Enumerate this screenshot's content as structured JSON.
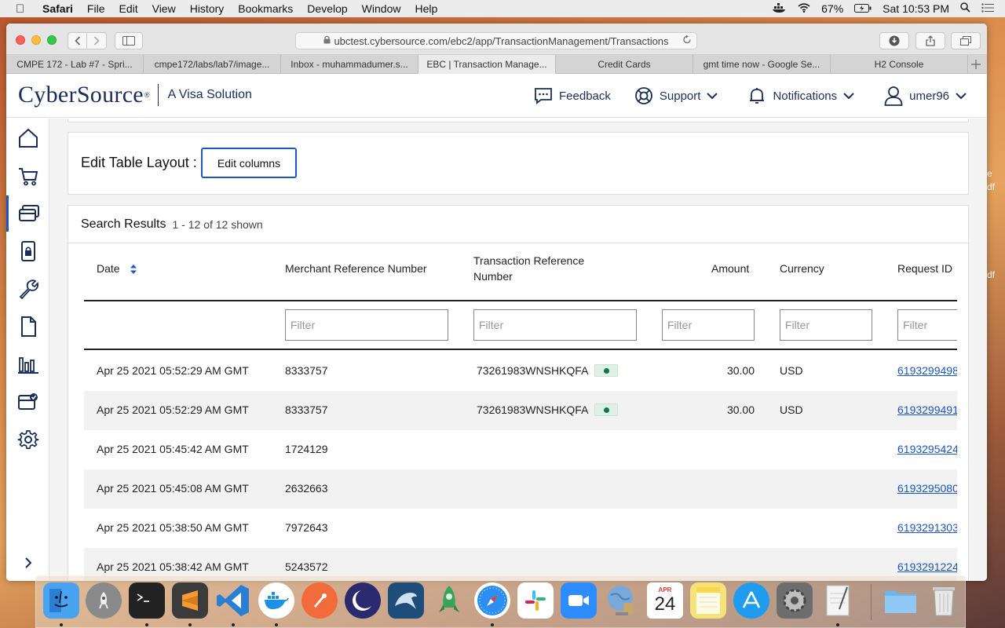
{
  "menubar": {
    "app": "Safari",
    "items": [
      "File",
      "Edit",
      "View",
      "History",
      "Bookmarks",
      "Develop",
      "Window",
      "Help"
    ],
    "battery": "67%",
    "clock": "Sat 10:53 PM"
  },
  "browser": {
    "url": "ubctest.cybersource.com/ebc2/app/TransactionManagement/Transactions",
    "tabs": [
      "CMPE 172 - Lab #7 - Spri...",
      "cmpe172/labs/lab7/image...",
      "Inbox - muhammadumer.s...",
      "EBC | Transaction Manage...",
      "Credit Cards",
      "gmt time now - Google Se...",
      "H2 Console"
    ],
    "active_tab_index": 3
  },
  "header": {
    "brand": "CyberSource",
    "brand_mark": "®",
    "tagline": "A Visa Solution",
    "feedback": "Feedback",
    "support": "Support",
    "notifications": "Notifications",
    "user": "umer96"
  },
  "sidebar": {
    "items": [
      "home-icon",
      "cart-icon",
      "cards-icon",
      "phone-lock-icon",
      "wrench-icon",
      "document-icon",
      "bar-chart-icon",
      "checklist-icon",
      "gear-icon"
    ],
    "active_index": 2,
    "expand": "›"
  },
  "edit_layout": {
    "label": "Edit Table Layout :",
    "button": "Edit columns"
  },
  "results": {
    "title": "Search Results",
    "count": "1 - 12 of 12 shown",
    "columns": {
      "date": "Date",
      "merchant_ref": "Merchant Reference Number",
      "txn_ref": "Transaction Reference Number",
      "amount": "Amount",
      "currency": "Currency",
      "request_id": "Request ID"
    },
    "filter_placeholder": "Filter",
    "rows": [
      {
        "date": "Apr 25 2021 05:52:29 AM GMT",
        "merchant_ref": "8333757",
        "txn_ref": "73261983WNSHKQFA",
        "amount": "30.00",
        "currency": "USD",
        "request_id": "6193299498"
      },
      {
        "date": "Apr 25 2021 05:52:29 AM GMT",
        "merchant_ref": "8333757",
        "txn_ref": "73261983WNSHKQFA",
        "amount": "30.00",
        "currency": "USD",
        "request_id": "6193299491"
      },
      {
        "date": "Apr 25 2021 05:45:42 AM GMT",
        "merchant_ref": "1724129",
        "txn_ref": "",
        "amount": "",
        "currency": "",
        "request_id": "6193295424"
      },
      {
        "date": "Apr 25 2021 05:45:08 AM GMT",
        "merchant_ref": "2632663",
        "txn_ref": "",
        "amount": "",
        "currency": "",
        "request_id": "6193295080"
      },
      {
        "date": "Apr 25 2021 05:38:50 AM GMT",
        "merchant_ref": "7972643",
        "txn_ref": "",
        "amount": "",
        "currency": "",
        "request_id": "6193291303"
      },
      {
        "date": "Apr 25 2021 05:38:42 AM GMT",
        "merchant_ref": "5243572",
        "txn_ref": "",
        "amount": "",
        "currency": "",
        "request_id": "6193291224"
      }
    ]
  },
  "desktop": {
    "side_text": [
      "e",
      "df",
      "df"
    ]
  },
  "dock": {
    "apps": [
      "Finder",
      "Launchpad",
      "Terminal",
      "Sublime Text",
      "Visual Studio Code",
      "Docker",
      "Postman",
      "Eclipse",
      "MySQL Workbench",
      "Git Tower",
      "Safari",
      "Slack",
      "Zoom",
      "Network Utility",
      "Calendar",
      "Notes",
      "App Store",
      "System Preferences",
      "TextEdit",
      "Downloads",
      "Trash"
    ],
    "calendar_month": "APR",
    "calendar_day": "24",
    "colors": [
      "#4aa3f0",
      "#8a8a8a",
      "#222222",
      "#3b3b3b",
      "#2a7fd4",
      "#1d8fe6",
      "#f26b3a",
      "#2c2a6e",
      "#1f4d7a",
      "#3aa35a",
      "#2a8ff0",
      "#ffffff",
      "#2d8cff",
      "#7aa8d8",
      "#ffffff",
      "#f5e27a",
      "#1f9bf0",
      "#6d6d6d",
      "#f4f4f4",
      "#6cb6ef",
      "#cfcfcf"
    ]
  }
}
